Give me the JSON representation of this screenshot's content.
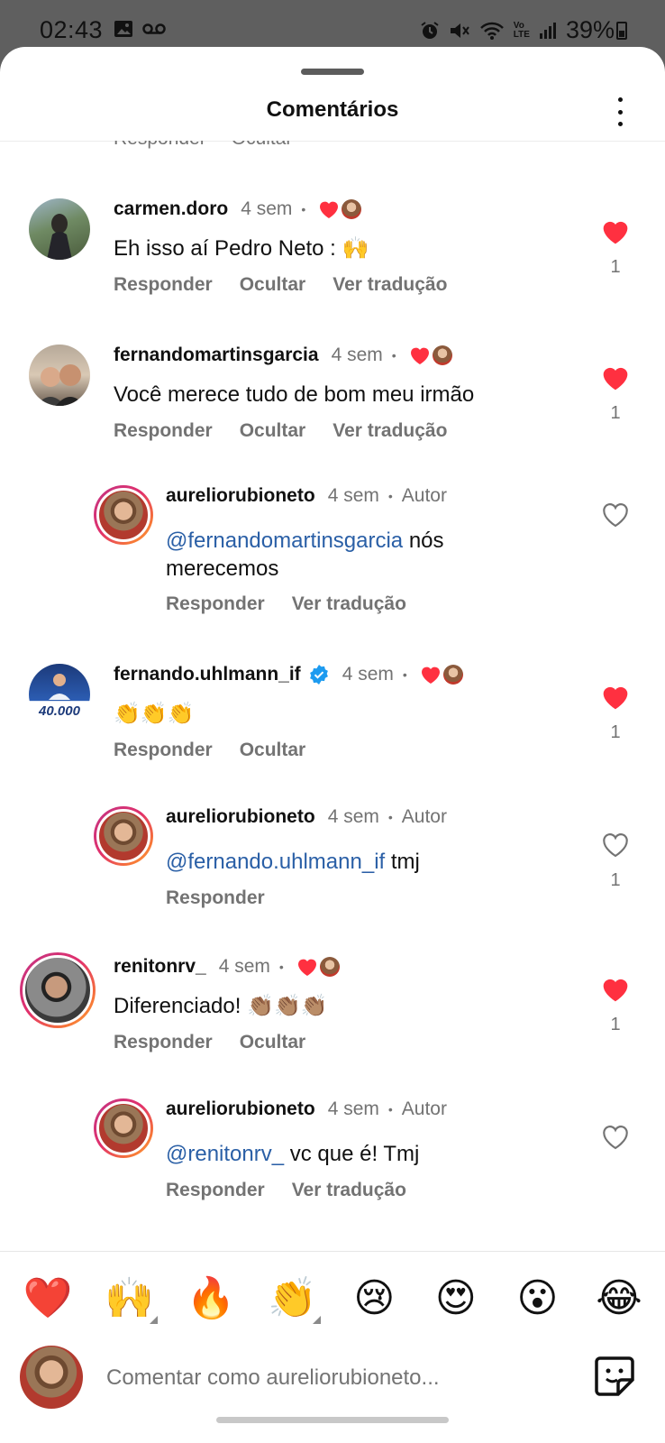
{
  "status_bar": {
    "time": "02:43",
    "battery": "39%",
    "left_icons": [
      "image-icon",
      "voicemail-icon"
    ],
    "right_icons": [
      "alarm-icon",
      "mute-icon",
      "wifi-icon",
      "volte-icon",
      "signal-icon",
      "battery-icon"
    ],
    "volte_label_top": "Vo",
    "volte_label_bottom": "LTE"
  },
  "header": {
    "title": "Comentários"
  },
  "partial_actions": [
    "Responder",
    "Ocultar"
  ],
  "comments": [
    {
      "user": "carmen.doro",
      "time": "4 sem",
      "dot": "•",
      "text": "Eh isso aí Pedro Neto : 🙌",
      "actions": [
        "Responder",
        "Ocultar",
        "Ver tradução"
      ],
      "liked": true,
      "likes": "1",
      "liked_by_author": true
    },
    {
      "user": "fernandomartinsgarcia",
      "time": "4 sem",
      "dot": "•",
      "text": "Você merece tudo de bom meu irmão",
      "actions": [
        "Responder",
        "Ocultar",
        "Ver tradução"
      ],
      "liked": true,
      "likes": "1",
      "liked_by_author": true
    },
    {
      "user": "aureliorubioneto",
      "time": "4 sem",
      "dot": "•",
      "author": "Autor",
      "mention": "@fernandomartinsgarcia",
      "text_line1": " nós",
      "text_line2": "merecemos",
      "actions": [
        "Responder",
        "Ver tradução"
      ],
      "liked": false,
      "likes": ""
    },
    {
      "user": "fernando.uhlmann_if",
      "verified": true,
      "time": "4 sem",
      "dot": "•",
      "text": "👏👏👏",
      "avatar_badge": "40.000",
      "actions": [
        "Responder",
        "Ocultar"
      ],
      "liked": true,
      "likes": "1",
      "liked_by_author": true
    },
    {
      "user": "aureliorubioneto",
      "time": "4 sem",
      "dot": "•",
      "author": "Autor",
      "mention": "@fernando.uhlmann_if",
      "text": " tmj",
      "actions": [
        "Responder"
      ],
      "liked": false,
      "likes": "1"
    },
    {
      "user": "renitonrv_",
      "time": "4 sem",
      "dot": "•",
      "text": "Diferenciado! 👏🏽👏🏽👏🏽",
      "actions": [
        "Responder",
        "Ocultar"
      ],
      "liked": true,
      "likes": "1",
      "liked_by_author": true
    },
    {
      "user": "aureliorubioneto",
      "time": "4 sem",
      "dot": "•",
      "author": "Autor",
      "mention": "@renitonrv_",
      "text": " vc que é! Tmj",
      "actions": [
        "Responder",
        "Ver tradução"
      ],
      "liked": false,
      "likes": ""
    }
  ],
  "quick_reactions": [
    "❤️",
    "🙌",
    "🔥",
    "👏",
    "😢",
    "😍",
    "😮",
    "😂"
  ],
  "composer": {
    "placeholder": "Comentar como aureliorubioneto..."
  },
  "colors": {
    "like_red": "#ff3040",
    "mention_blue": "#2a5fa6",
    "muted_gray": "#737373"
  }
}
